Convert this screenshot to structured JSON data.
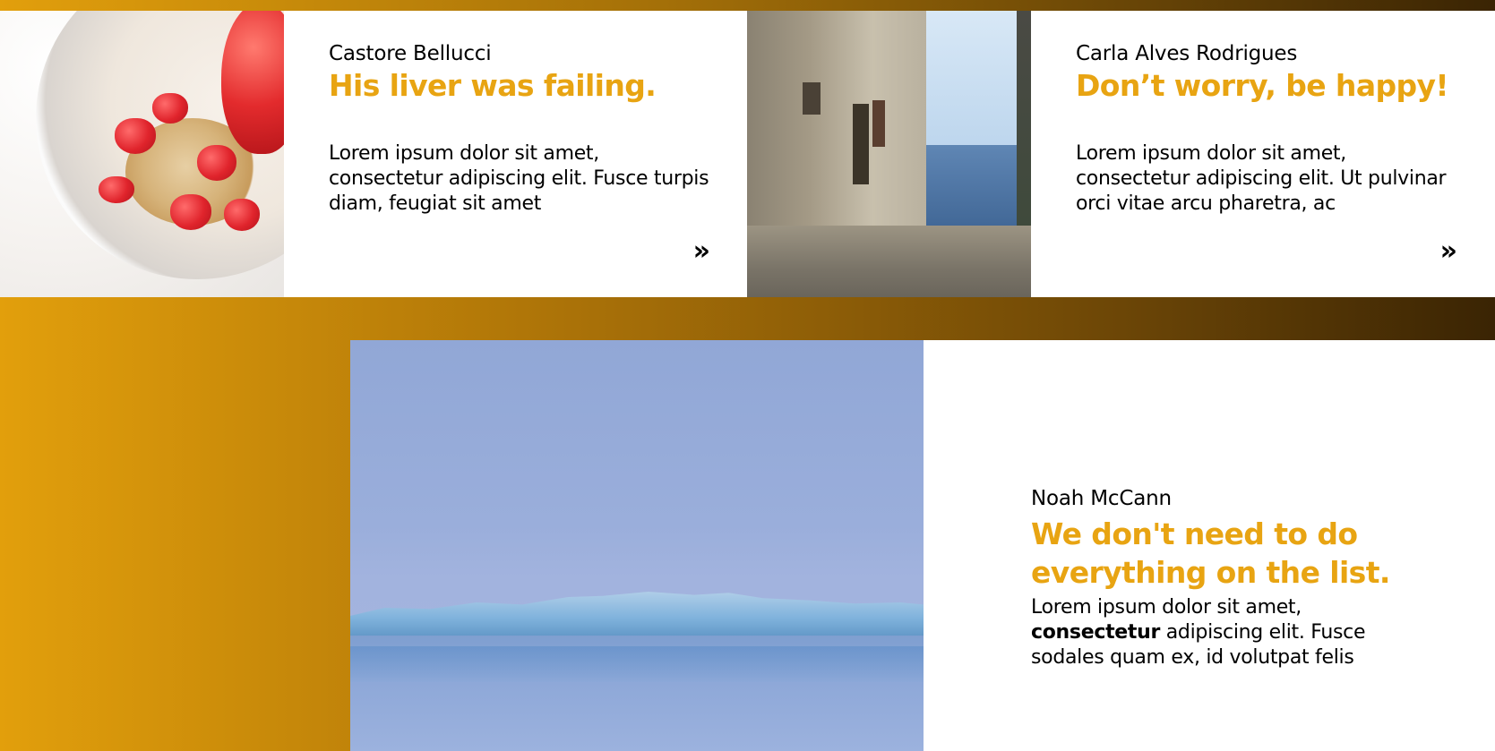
{
  "posts": [
    {
      "author": "Castore Bellucci",
      "title": "His liver was failing.",
      "excerpt": "Lorem ipsum dolor sit amet, consectetur adipiscing elit. Fusce turpis diam, feugiat sit amet",
      "more": "»"
    },
    {
      "author": "Carla Alves Rodrigues",
      "title": "Don’t worry, be happy!",
      "excerpt": "Lorem ipsum dolor sit amet, consectetur adipiscing elit. Ut pulvinar orci vitae arcu pharetra, ac",
      "more": "»"
    }
  ],
  "featured": {
    "author": "Noah McCann",
    "title": "We don't need to do everything on the list.",
    "excerpt_start": "Lorem ipsum dolor sit amet,",
    "excerpt_bold": "consectetur",
    "excerpt_end": " adipiscing elit. Fusce sodales quam ex, id volutpat felis"
  },
  "colors": {
    "accent": "#e8a412",
    "gradient_start": "#e29f0c",
    "gradient_end": "#3a2404"
  }
}
